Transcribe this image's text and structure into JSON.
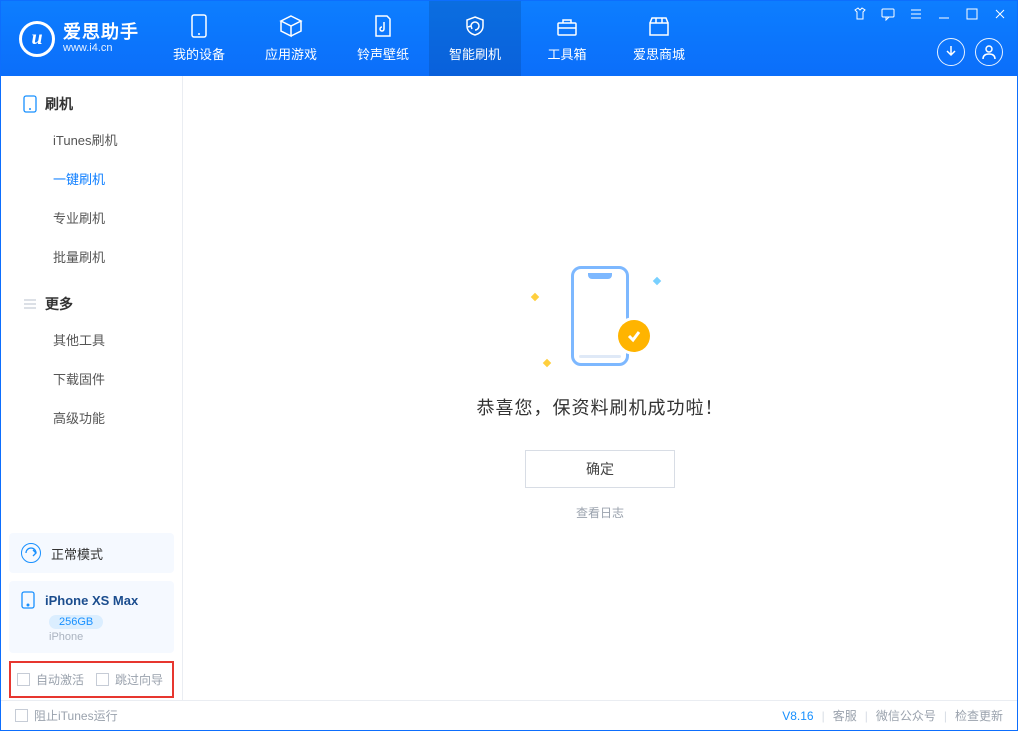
{
  "app": {
    "name_cn": "爱思助手",
    "url": "www.i4.cn"
  },
  "nav": {
    "items": [
      {
        "label": "我的设备"
      },
      {
        "label": "应用游戏"
      },
      {
        "label": "铃声壁纸"
      },
      {
        "label": "智能刷机"
      },
      {
        "label": "工具箱"
      },
      {
        "label": "爱思商城"
      }
    ]
  },
  "sidebar": {
    "group1": {
      "title": "刷机",
      "items": [
        {
          "label": "iTunes刷机"
        },
        {
          "label": "一键刷机"
        },
        {
          "label": "专业刷机"
        },
        {
          "label": "批量刷机"
        }
      ]
    },
    "group2": {
      "title": "更多",
      "items": [
        {
          "label": "其他工具"
        },
        {
          "label": "下载固件"
        },
        {
          "label": "高级功能"
        }
      ]
    },
    "mode": {
      "label": "正常模式"
    },
    "device": {
      "name": "iPhone XS Max",
      "capacity": "256GB",
      "type": "iPhone"
    },
    "options": {
      "auto_activate": "自动激活",
      "skip_wizard": "跳过向导"
    }
  },
  "main": {
    "success_message": "恭喜您，保资料刷机成功啦！",
    "ok_button": "确定",
    "view_log": "查看日志"
  },
  "footer": {
    "block_itunes": "阻止iTunes运行",
    "version": "V8.16",
    "support": "客服",
    "wechat": "微信公众号",
    "check_update": "检查更新"
  }
}
